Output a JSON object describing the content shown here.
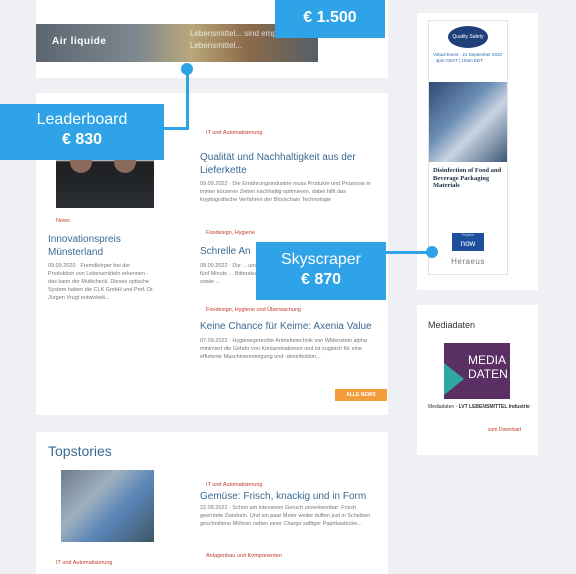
{
  "top_banner": {
    "logo": "Air liquide",
    "text": "Lebensmittel... sind empfindliche Lebensmittel..."
  },
  "badges": {
    "top": {
      "price": "€ 1.500"
    },
    "leaderboard": {
      "label": "Leaderboard",
      "price": "€ 830"
    },
    "skyscraper": {
      "label": "Skyscraper",
      "price": "€ 870"
    }
  },
  "news": {
    "left": {
      "tag": "News",
      "title": "Innovationspreis Münsterland",
      "excerpt": "09.09.2020 · Fremdkörper bei der Produktion von Lebensmitteln erkennen - das kann der Multicheck. Dieses optische System haben die CLK GmbH und Prof. Dr. Jürgen Vrugt entwickelt..."
    },
    "items": [
      {
        "tag": "IT und Automatisierung",
        "title": "Qualität und Nachhaltigkeit aus der Lieferkette",
        "excerpt": "09.09.2022 · Die Ernährungsindustrie muss Produkte und Prozesse in immer kürzeren Zeiten nachhaltig optimieren, dabei hilft das kryptografische Verfahren der Blockchain Technologie"
      },
      {
        "tag": "Foodesign, Hygiene",
        "title": "Schrelle An",
        "excerpt": "08.09.2022 · Die ... unser fünf Minute ... Bitterskuren sowie ..."
      },
      {
        "tag": "Foodesign, Hygiene und Überwachung",
        "title": "Keine Chance für Keime: Axenia Value",
        "excerpt": "07.09.2022 · Hygienegerechte Antriebstechnik von Wittenstein alpha minimiert die Gefahr von Kontaminationen und ist zugleich für eine effiziente Maschinenreinigung und -desinfektion..."
      }
    ],
    "alle_news": "ALLE NEWS"
  },
  "topstories": {
    "heading": "Topstories",
    "items": [
      {
        "tag": "IT und Automatisierung",
        "title": "Gemüse: Frisch, knackig und in Form",
        "excerpt": "22.08.2022 · Schon am intensiven Geruch unverkennbar: Frisch geerntete Zwiebeln. Und ein paar Meter weiter duften just in Scheiben geschnittene Möhren neben einer Charge saftiger Paprikastücke..."
      },
      {
        "tag": "IT und Automatisierung",
        "title": "",
        "excerpt": ""
      },
      {
        "tag": "Anlagenbau und Komponenten",
        "title": "",
        "excerpt": ""
      }
    ]
  },
  "skyscraper_ad": {
    "logo": "Quality Safety",
    "event": "Virtual Event · 21 September 2022 · 4pm CEST | 10am EDT",
    "headline": "Disinfection of Food and Beverage Packaging Materials",
    "button_small": "Register",
    "button": "now",
    "brand": "Heraeus"
  },
  "mediadaten": {
    "heading": "Mediadaten",
    "logo_text_1": "MEDIA",
    "logo_text_2": "DATEN",
    "caption_prefix": "Mediadaten - ",
    "caption_bold": "LVT LEBENSMITTEL Industrie",
    "download": "zum Download"
  },
  "colors": {
    "badge": "#2ea3e8",
    "link": "#3a6a93",
    "tag": "#c0392b",
    "button": "#f39c3c",
    "media": "#5a2f64"
  }
}
